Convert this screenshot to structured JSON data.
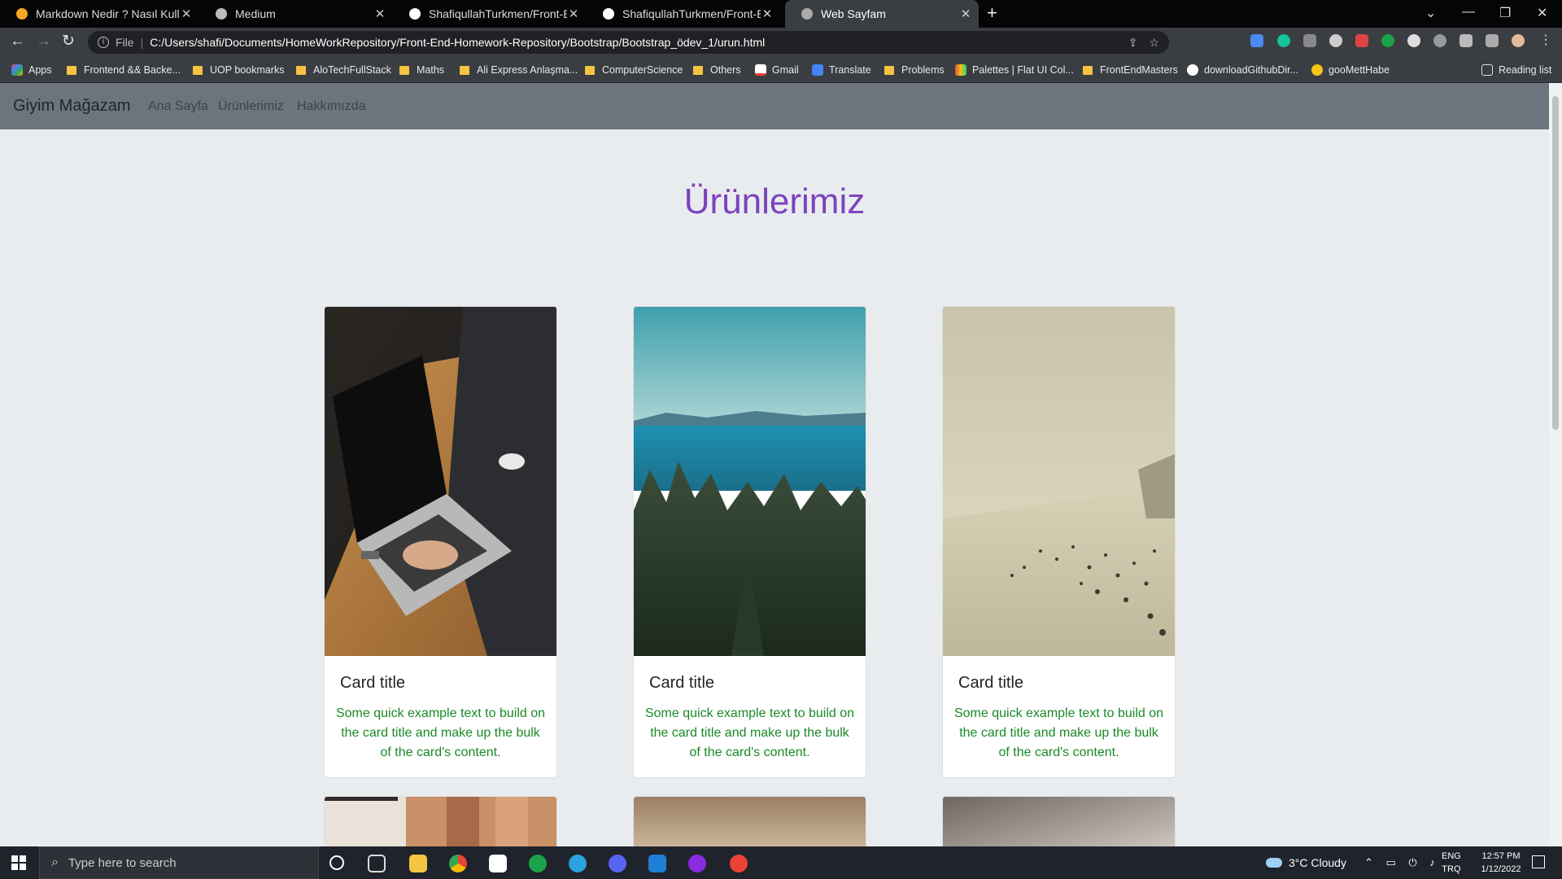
{
  "browser": {
    "tabs": [
      {
        "title": "Markdown Nedir ? Nasıl Kullanılır",
        "favicon": "#f5a623",
        "active": false
      },
      {
        "title": "Medium",
        "favicon": "#cccccc",
        "active": false
      },
      {
        "title": "ShafiqullahTurkmen/Front-End-Homework",
        "favicon": "#ffffff",
        "active": false
      },
      {
        "title": "ShafiqullahTurkmen/Front-End-Homework",
        "favicon": "#ffffff",
        "active": false
      },
      {
        "title": "Web Sayfam",
        "favicon": "#cccccc",
        "active": true
      }
    ],
    "address": {
      "scheme": "File",
      "url": "C:/Users/shafi/Documents/HomeWorkRepository/Front-End-Homework-Repository/Bootstrap/Bootstrap_ödev_1/urun.html"
    },
    "bookmarks": [
      {
        "label": "Apps",
        "kind": "apps"
      },
      {
        "label": "Frontend && Backe...",
        "kind": "folder"
      },
      {
        "label": "UOP bookmarks",
        "kind": "folder"
      },
      {
        "label": "AloTechFullStack",
        "kind": "folder"
      },
      {
        "label": "Maths",
        "kind": "folder"
      },
      {
        "label": "Ali Express Anlaşma...",
        "kind": "folder"
      },
      {
        "label": "ComputerScience",
        "kind": "folder"
      },
      {
        "label": "Others",
        "kind": "folder"
      },
      {
        "label": "Gmail",
        "kind": "gmail"
      },
      {
        "label": "Translate",
        "kind": "translate"
      },
      {
        "label": "Problems",
        "kind": "folder"
      },
      {
        "label": "Palettes | Flat UI Col...",
        "kind": "palette"
      },
      {
        "label": "FrontEndMasters",
        "kind": "folder"
      },
      {
        "label": "downloadGithubDir...",
        "kind": "github"
      },
      {
        "label": "gooMettHabe",
        "kind": "site"
      },
      {
        "label": "Reading list",
        "kind": "reading"
      }
    ]
  },
  "site": {
    "brand": "Giyim Mağazam",
    "nav": [
      "Ana Sayfa",
      "Ürünlerimiz",
      "Hakkımızda"
    ],
    "heading": "Ürünlerimiz",
    "cards": [
      {
        "title": "Card title",
        "text": "Some quick example text to build on the card title and make up the bulk of the card's content.",
        "image": "laptop-photo"
      },
      {
        "title": "Card title",
        "text": "Some quick example text to build on the card title and make up the bulk of the card's content.",
        "image": "forest-lake-photo"
      },
      {
        "title": "Card title",
        "text": "Some quick example text to build on the card title and make up the bulk of the card's content.",
        "image": "beach-photo"
      }
    ],
    "colors": {
      "heading": "#7c43bd",
      "navbar": "#6c757d",
      "card_text": "#1a8a26"
    }
  },
  "taskbar": {
    "search_placeholder": "Type here to search",
    "weather": "3°C  Cloudy",
    "lang1": "ENG",
    "lang2": "TRQ",
    "time": "12:57 PM",
    "date": "1/12/2022"
  }
}
